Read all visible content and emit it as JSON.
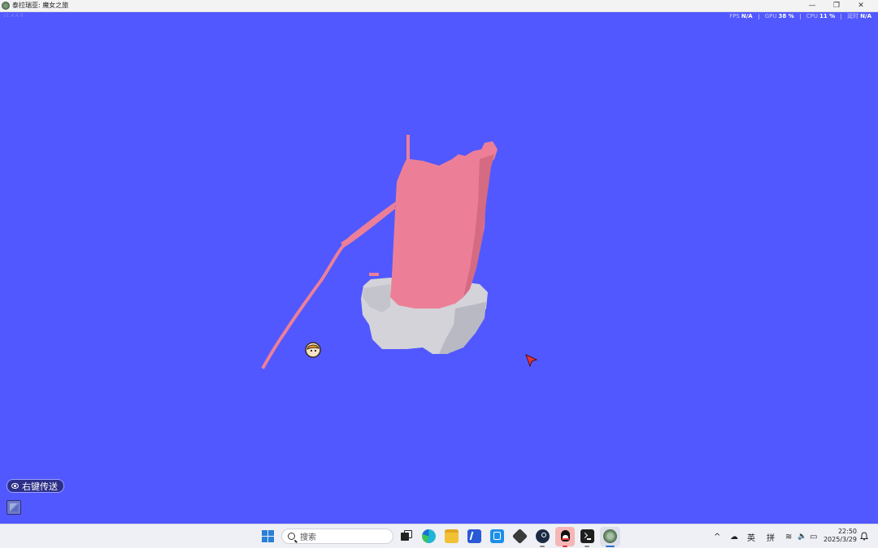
{
  "window": {
    "title": "泰拉瑞亚: 魔女之旅",
    "minimize_glyph": "—",
    "restore_glyph": "❐",
    "close_glyph": "✕"
  },
  "hud": {
    "version_text": "v1.4.4.9",
    "stats": [
      {
        "label": "FPS",
        "value": "N/A"
      },
      {
        "label": "GPU",
        "value": "38 %"
      },
      {
        "label": "CPU",
        "value": "11 %"
      },
      {
        "label": "延时",
        "value": "N/A"
      }
    ]
  },
  "game": {
    "sky_color": "#5158ff",
    "tree_color": "#ec7f97",
    "tree_shadow": "#d56a83",
    "cloud_color": "#d3d3d9",
    "cloud_shadow": "#b9b9c4",
    "teleport_hint": "右键传送",
    "map_icon": "world-map-icon",
    "player_icon": "player-head-icon",
    "cursor_icon": "red-arrow-cursor-icon"
  },
  "taskbar": {
    "search_placeholder": "搜索",
    "apps": [
      "task-view-icon",
      "edge-icon",
      "file-explorer-icon",
      "adobe-app-icon",
      "app-store-icon",
      "unity-hub-icon",
      "steam-icon",
      "qq-icon",
      "terminal-icon",
      "terraria-icon"
    ],
    "tray": {
      "chevron": "^",
      "weather_glyph": "☁",
      "ime_lang": "英",
      "ime_mode": "拼",
      "wifi_glyph": "≋",
      "volume_glyph": "🔈",
      "battery_glyph": "▭"
    },
    "clock_time": "22:50",
    "clock_date": "2025/3/29"
  }
}
